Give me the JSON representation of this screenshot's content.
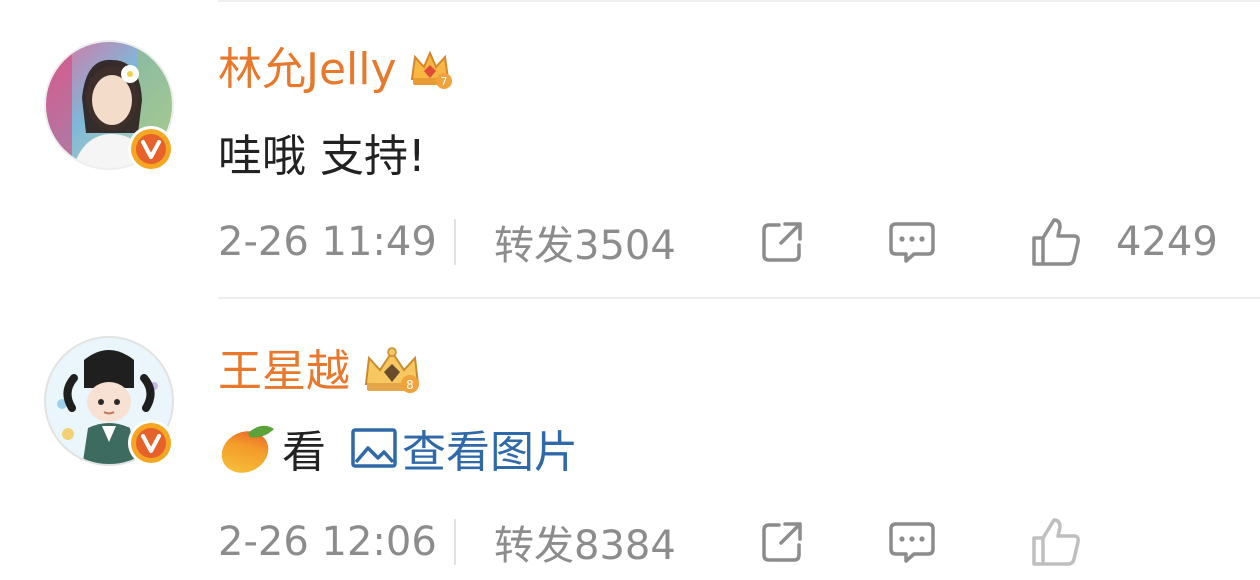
{
  "comments": [
    {
      "username": "林允Jelly",
      "text": "哇哦 支持!",
      "time": "2-26 11:49",
      "repost_label": "转发3504",
      "like_count": "4249"
    },
    {
      "username": "王星越",
      "text": "看",
      "image_link_label": "查看图片",
      "time": "2-26 12:06",
      "repost_label": "转发8384",
      "like_count": ""
    }
  ],
  "icons": {
    "share": "share-icon",
    "comment": "comment-icon",
    "like": "thumbs-up-icon",
    "verified": "verified-badge-icon",
    "crown": "crown-badge-icon",
    "mango": "mango-emoji-icon",
    "image": "image-icon"
  },
  "colors": {
    "username": "#e8782c",
    "link": "#2f69a8",
    "meta": "#8c8c8c",
    "badge": "#f5a623"
  }
}
